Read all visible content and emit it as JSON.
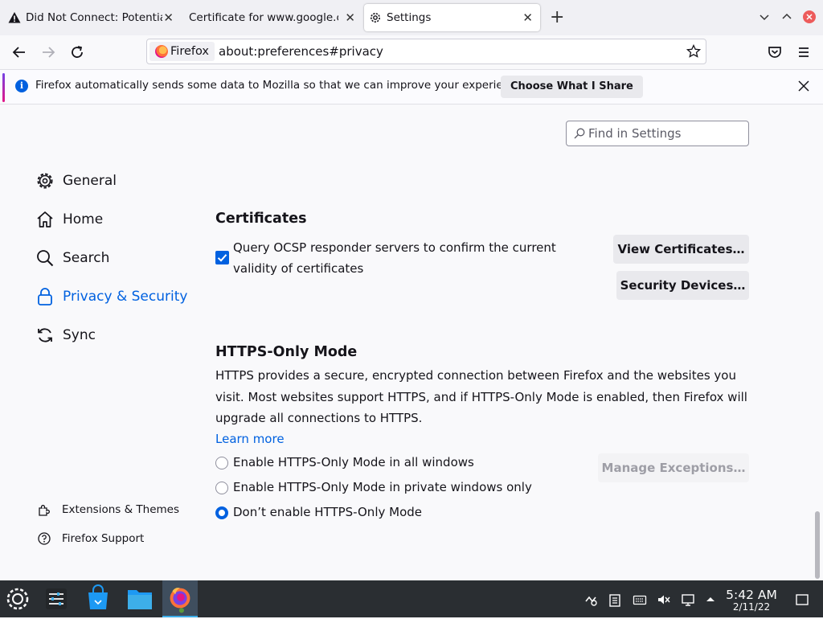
{
  "tabs": [
    {
      "title": "Did Not Connect: Potential Security Issue",
      "icon": "warning-icon"
    },
    {
      "title": "Certificate for www.google.com",
      "icon": ""
    },
    {
      "title": "Settings",
      "icon": "gear-icon"
    }
  ],
  "navbar": {
    "identity_label": "Firefox",
    "url": "about:preferences#privacy"
  },
  "infobar": {
    "message": "Firefox automatically sends some data to Mozilla so that we can improve your experience.",
    "button_label": "Choose What I Share"
  },
  "search": {
    "placeholder": "Find in Settings"
  },
  "sidebar": {
    "categories": [
      {
        "label": "General",
        "icon": "gear-icon"
      },
      {
        "label": "Home",
        "icon": "home-icon"
      },
      {
        "label": "Search",
        "icon": "search-icon"
      },
      {
        "label": "Privacy & Security",
        "icon": "lock-icon",
        "selected": true
      },
      {
        "label": "Sync",
        "icon": "sync-icon"
      }
    ],
    "footer": [
      {
        "label": "Extensions & Themes",
        "icon": "puzzle-icon"
      },
      {
        "label": "Firefox Support",
        "icon": "help-icon"
      }
    ]
  },
  "certificates": {
    "heading": "Certificates",
    "ocsp_label": "Query OCSP responder servers to confirm the current validity of certificates",
    "ocsp_checked": true,
    "view_button": "View Certificates…",
    "devices_button": "Security Devices…"
  },
  "https_only": {
    "heading": "HTTPS-Only Mode",
    "description": "HTTPS provides a secure, encrypted connection between Firefox and the websites you visit. Most websites support HTTPS, and if HTTPS-Only Mode is enabled, then Firefox will upgrade all connections to HTTPS.",
    "learn_more": "Learn more",
    "options": [
      {
        "label": "Enable HTTPS-Only Mode in all windows",
        "selected": false
      },
      {
        "label": "Enable HTTPS-Only Mode in private windows only",
        "selected": false
      },
      {
        "label": "Don’t enable HTTPS-Only Mode",
        "selected": true
      }
    ],
    "exceptions_button": "Manage Exceptions…"
  },
  "taskbar": {
    "time": "5:42 AM",
    "date": "2/11/22"
  },
  "colors": {
    "accent": "#0061e0",
    "taskbar": "#2a2e32"
  }
}
